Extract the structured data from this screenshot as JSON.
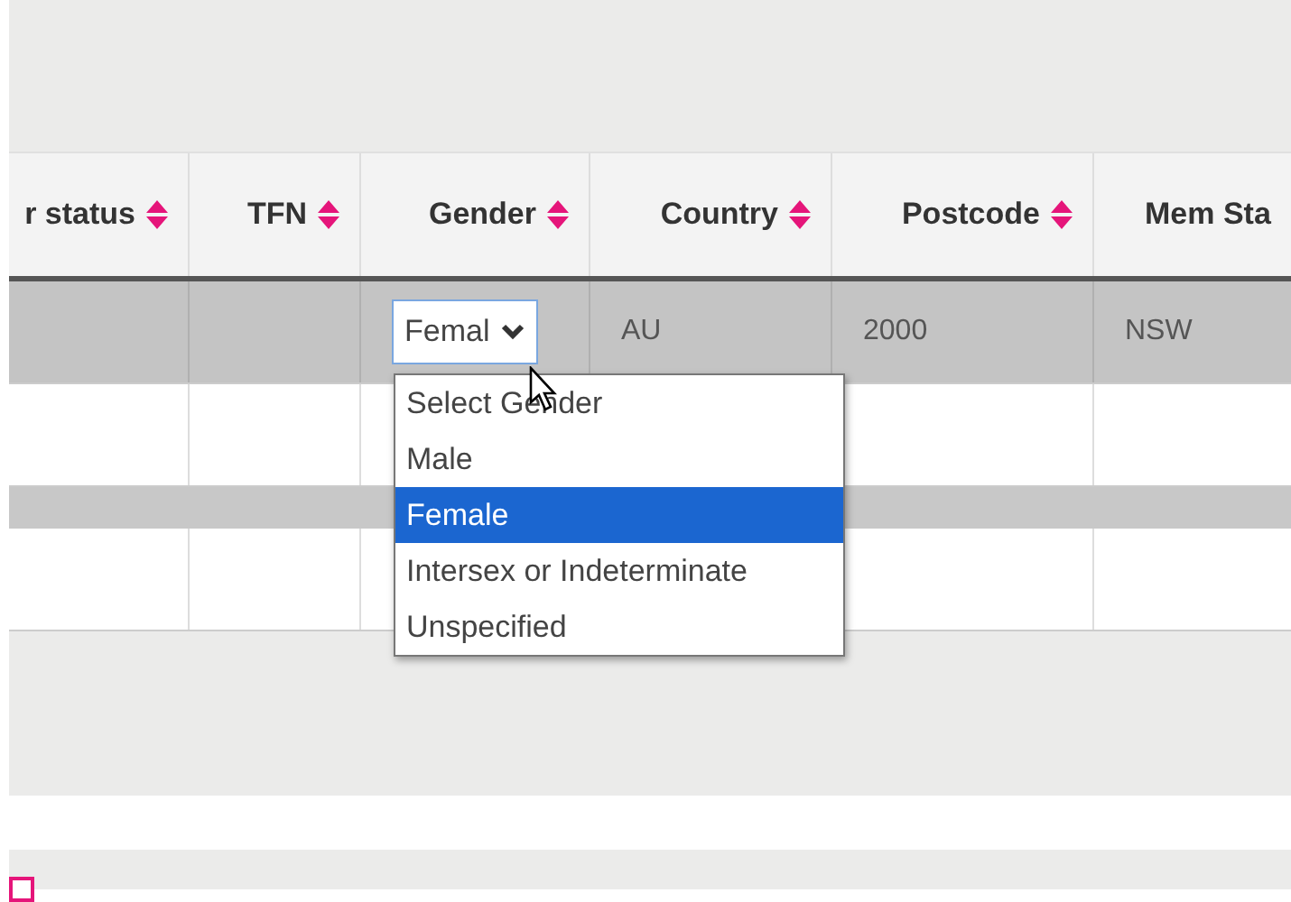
{
  "table": {
    "columns": [
      {
        "label": "r status",
        "sortable": true
      },
      {
        "label": "TFN",
        "sortable": true
      },
      {
        "label": "Gender",
        "sortable": true
      },
      {
        "label": "Country",
        "sortable": true
      },
      {
        "label": "Postcode",
        "sortable": true
      },
      {
        "label": "Mem Sta",
        "sortable": false
      }
    ],
    "rows": [
      {
        "highlighted": true,
        "cells": [
          {
            "kind": "empty"
          },
          {
            "kind": "empty"
          },
          {
            "kind": "select",
            "value": "Femal"
          },
          {
            "kind": "text",
            "text": "AU"
          },
          {
            "kind": "text",
            "text": "2000"
          },
          {
            "kind": "text",
            "text": "NSW"
          }
        ]
      },
      {
        "highlighted": false,
        "cells": []
      },
      {
        "kind": "band"
      },
      {
        "highlighted": false,
        "cells": []
      }
    ]
  },
  "dropdown": {
    "options": [
      {
        "label": "Select Gender",
        "selected": false
      },
      {
        "label": "Male",
        "selected": false
      },
      {
        "label": "Female",
        "selected": true
      },
      {
        "label": "Intersex or Indeterminate",
        "selected": false
      },
      {
        "label": "Unspecified",
        "selected": false
      }
    ]
  },
  "footer": {
    "checkbox": {
      "checked": false
    }
  }
}
